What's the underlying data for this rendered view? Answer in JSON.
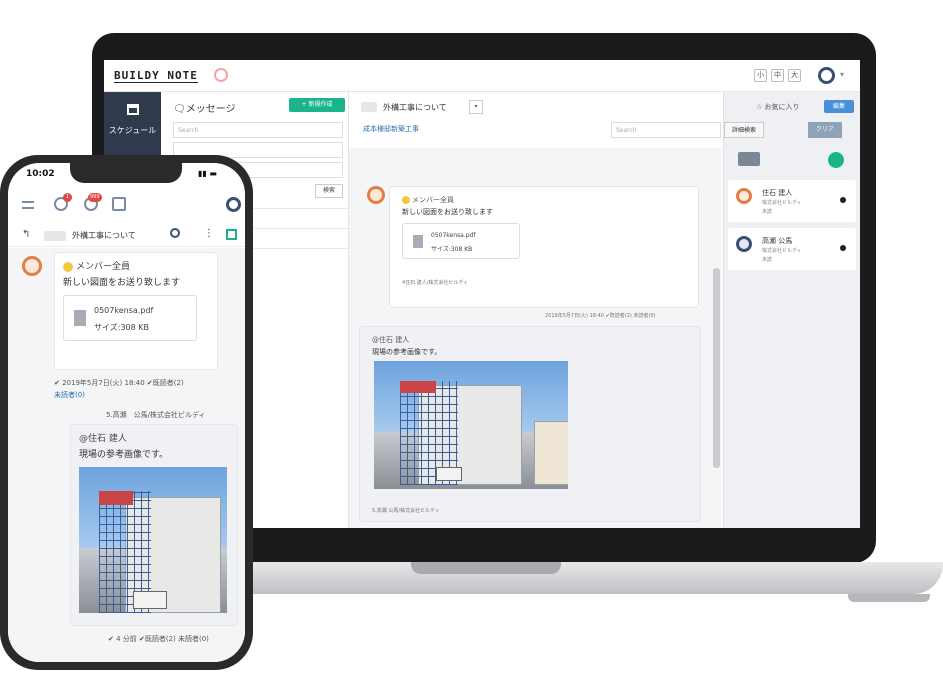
{
  "laptop": {
    "logo": "BUILDY NOTE",
    "font_sizes": [
      "小",
      "中",
      "大"
    ],
    "nav": {
      "schedule_label": "スケジュール"
    },
    "message_panel": {
      "title": "メッセージ",
      "new_button": "+ 新規作成",
      "search_placeholder": "Search",
      "search_button": "検索"
    },
    "thread": {
      "title": "外構工事について",
      "subtitle": "成本様邸新築工事",
      "search_placeholder": "Search"
    },
    "messages": [
      {
        "mention": "メンバー全員",
        "text": "新しい図面をお送り致します",
        "file_name": "0507kensa.pdf",
        "file_size": "サイズ:308 KB",
        "sender": "4住石 建人/株式会社ビルディ",
        "meta": "2019年5月7日(火) 18:40 ✔既読者(2) 未読者(0)"
      },
      {
        "mention": "@住石 建人",
        "text": "現場の参考画像です。",
        "sender": "5.高瀬 公馬/株式会社ビルディ"
      }
    ],
    "members": {
      "favorite": "お気に入り",
      "edit": "編集",
      "detail": "詳細検索",
      "clear": "クリア",
      "list": [
        {
          "name": "住石 建人",
          "company": "株式会社ビルディ",
          "status": "未読"
        },
        {
          "name": "高瀬 公馬",
          "company": "株式会社ビルディ",
          "status": "未読"
        }
      ]
    }
  },
  "phone": {
    "clock": "10:02",
    "badges": [
      "1",
      "999"
    ],
    "thread_title": "外構工事について",
    "messages": [
      {
        "mention": "メンバー全員",
        "text": "新しい図面をお送り致します",
        "file_name": "0507kensa.pdf",
        "file_size": "サイズ:308 KB",
        "meta": "✔ 2019年5月7日(火) 18:40 ✔既読者(2)",
        "meta2": "未読者(0)"
      },
      {
        "sender": "5.高瀬　公馬/株式会社ビルディ",
        "mention": "@住石 建人",
        "text": "現場の参考画像です。",
        "meta": "✔ 4 分前 ✔既読者(2) 未読者(0)"
      }
    ]
  },
  "colors": {
    "accent": "#1bb38a",
    "nav": "#2f3b4c",
    "blue": "#4a90d9",
    "badge": "#e04848"
  }
}
